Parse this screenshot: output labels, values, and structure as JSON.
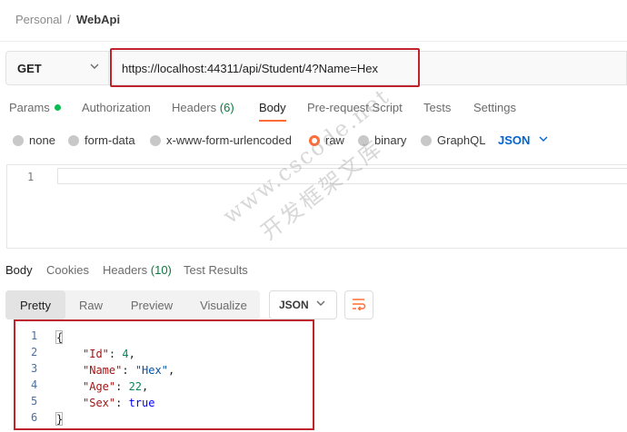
{
  "breadcrumb": {
    "workspace": "Personal",
    "separator": "/",
    "current": "WebApi"
  },
  "request": {
    "method": "GET",
    "url": "https://localhost:44311/api/Student/4?Name=Hex"
  },
  "request_tabs": {
    "params": "Params",
    "authorization": "Authorization",
    "headers": "Headers",
    "headers_count": "(6)",
    "body": "Body",
    "prerequest": "Pre-request Script",
    "tests": "Tests",
    "settings": "Settings"
  },
  "body_types": {
    "none": "none",
    "form_data": "form-data",
    "urlencoded": "x-www-form-urlencoded",
    "raw": "raw",
    "binary": "binary",
    "graphql": "GraphQL",
    "format": "JSON",
    "selected": "raw"
  },
  "editor": {
    "line_number": "1"
  },
  "response_tabs": {
    "body": "Body",
    "cookies": "Cookies",
    "headers": "Headers",
    "headers_count": "(10)",
    "test_results": "Test Results"
  },
  "view_modes": {
    "pretty": "Pretty",
    "raw": "Raw",
    "preview": "Preview",
    "visualize": "Visualize",
    "selected": "Pretty",
    "format": "JSON"
  },
  "response": {
    "line_numbers": [
      "1",
      "2",
      "3",
      "4",
      "5",
      "6"
    ],
    "open_brace": "{",
    "close_brace": "}",
    "fields": [
      {
        "key": "\"Id\"",
        "value": "4",
        "type": "number",
        "comma": ","
      },
      {
        "key": "\"Name\"",
        "value": "\"Hex\"",
        "type": "string",
        "comma": ","
      },
      {
        "key": "\"Age\"",
        "value": "22",
        "type": "number",
        "comma": ","
      },
      {
        "key": "\"Sex\"",
        "value": "true",
        "type": "boolean",
        "comma": ""
      }
    ]
  },
  "watermark": {
    "line1": "www.cscode.net",
    "line2": "开发框架文库"
  },
  "colors": {
    "accent": "#ff6c37",
    "highlight_box": "#c0232b",
    "json_blue": "#0265d2",
    "ok_green": "#0cbb52"
  },
  "icons": {
    "method_dropdown": "chevron-down-icon",
    "wrap": "wrap-lines-icon",
    "format_dropdown": "chevron-down-icon"
  }
}
